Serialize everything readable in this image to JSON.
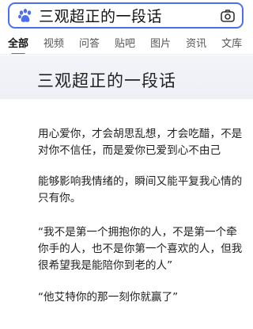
{
  "search": {
    "query": "三观超正的一段话",
    "logo_icon": "baidu-paw-icon",
    "camera_icon": "camera-icon"
  },
  "tabs": [
    {
      "label": "全部",
      "active": true
    },
    {
      "label": "视频",
      "active": false
    },
    {
      "label": "问答",
      "active": false
    },
    {
      "label": "贴吧",
      "active": false
    },
    {
      "label": "图片",
      "active": false
    },
    {
      "label": "资讯",
      "active": false
    },
    {
      "label": "文库",
      "active": false
    }
  ],
  "article": {
    "title": "三观超正的一段话",
    "paragraphs": [
      "用心爱你，才会胡思乱想，才会吃醋，不是对你不信任，而是爱你已爱到心不由己",
      "能够影响我情绪的，瞬间又能平复我心情的只有你。",
      "“我不是第一个拥抱你的人，不是第一个牵你手的人，也不是你第一个喜欢的人，但我很希望我是能陪你到老的人”",
      "“他艾特你的那一刻你就赢了”"
    ]
  },
  "colors": {
    "accent": "#4e6ef2"
  }
}
